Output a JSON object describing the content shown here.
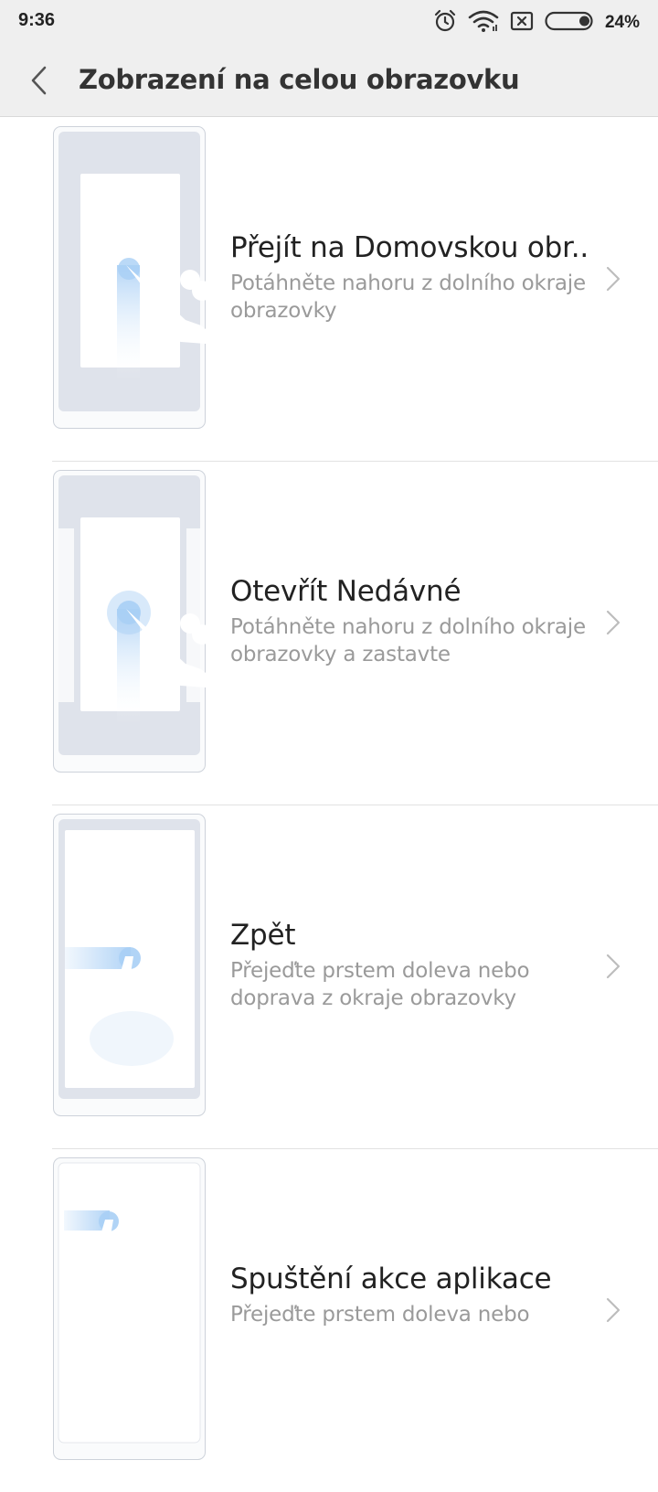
{
  "status_bar": {
    "time": "9:36",
    "battery_percent": "24%",
    "battery_level": 0.24,
    "icons": [
      "alarm-icon",
      "wifi-icon",
      "no-sim-icon",
      "battery-icon"
    ]
  },
  "toolbar": {
    "title": "Zobrazení na celou obrazovku",
    "back_icon": "back-chevron-icon"
  },
  "items": [
    {
      "title": "Přejít na Domovskou obr..",
      "subtitle": "Potáhněte nahoru z dolního okraje obrazovky",
      "illustration": "gesture-swipe-up-home"
    },
    {
      "title": "Otevřít Nedávné",
      "subtitle": "Potáhněte nahoru z dolního okraje obrazovky a zastavte",
      "illustration": "gesture-swipe-up-hold-recents"
    },
    {
      "title": "Zpět",
      "subtitle": "Přejeďte prstem doleva nebo doprava z okraje obrazovky",
      "illustration": "gesture-swipe-side-back"
    },
    {
      "title": "Spuštění akce aplikace",
      "subtitle": "Přejeďte prstem doleva nebo",
      "illustration": "gesture-swipe-side-app-action"
    }
  ],
  "colors": {
    "bar_background": "#efefef",
    "phone_frame": "#dfe3eb",
    "gesture_highlight": "#a9cff5",
    "title_text": "#222222",
    "subtitle_text": "#9a9a9a"
  }
}
